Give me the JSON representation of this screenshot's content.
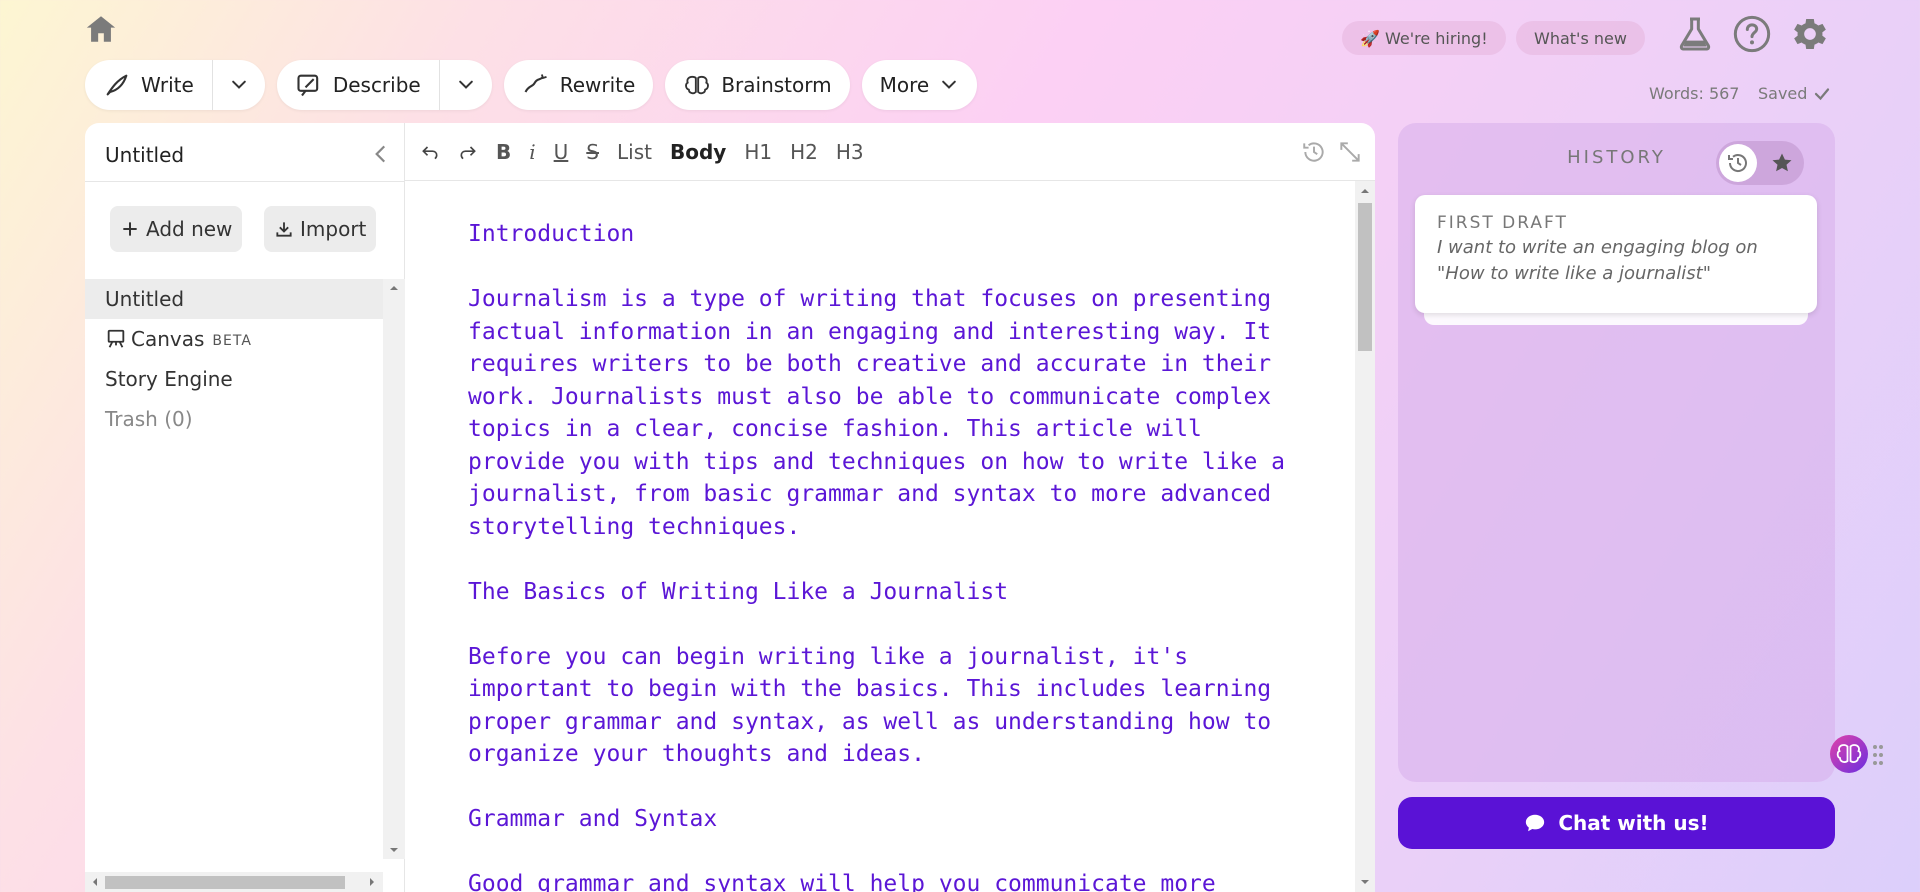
{
  "toolbar": {
    "write_label": "Write",
    "describe_label": "Describe",
    "rewrite_label": "Rewrite",
    "brainstorm_label": "Brainstorm",
    "more_label": "More"
  },
  "top_right": {
    "hiring_label": "🚀 We're hiring!",
    "whats_new_label": "What's new",
    "words": "Words: 567",
    "saved": "Saved"
  },
  "left_panel": {
    "doc_title": "Untitled",
    "add_new_label": "Add new",
    "import_label": "Import",
    "items": [
      {
        "label": "Untitled"
      },
      {
        "label": "Canvas",
        "badge": "BETA"
      },
      {
        "label": "Story Engine"
      },
      {
        "label": "Trash (0)"
      }
    ]
  },
  "editor_toolbar": {
    "bold": "B",
    "italic": "i",
    "underline": "U",
    "strike": "S",
    "list": "List",
    "body": "Body",
    "h1": "H1",
    "h2": "H2",
    "h3": "H3"
  },
  "editor": {
    "paragraphs": [
      "Introduction",
      "Journalism is a type of writing that focuses on presenting factual information in an engaging and interesting way. It requires writers to be both creative and accurate in their work. Journalists must also be able to communicate complex topics in a clear, concise fashion. This article will provide you with tips and techniques on how to write like a journalist, from basic grammar and syntax to more advanced storytelling techniques.",
      "The Basics of Writing Like a Journalist",
      "Before you can begin writing like a journalist, it's important to begin with the basics. This includes learning proper grammar and syntax, as well as understanding how to organize your thoughts and ideas.",
      "Grammar and Syntax",
      "Good grammar and syntax will help you communicate more"
    ]
  },
  "history": {
    "title": "HISTORY",
    "draft_label": "FIRST DRAFT",
    "draft_text": "I want to write an engaging blog on \"How to write like a journalist\""
  },
  "chat": {
    "label": "Chat with us!"
  },
  "colors": {
    "accent": "#5a12d6",
    "editor_text": "#5b16d6"
  }
}
